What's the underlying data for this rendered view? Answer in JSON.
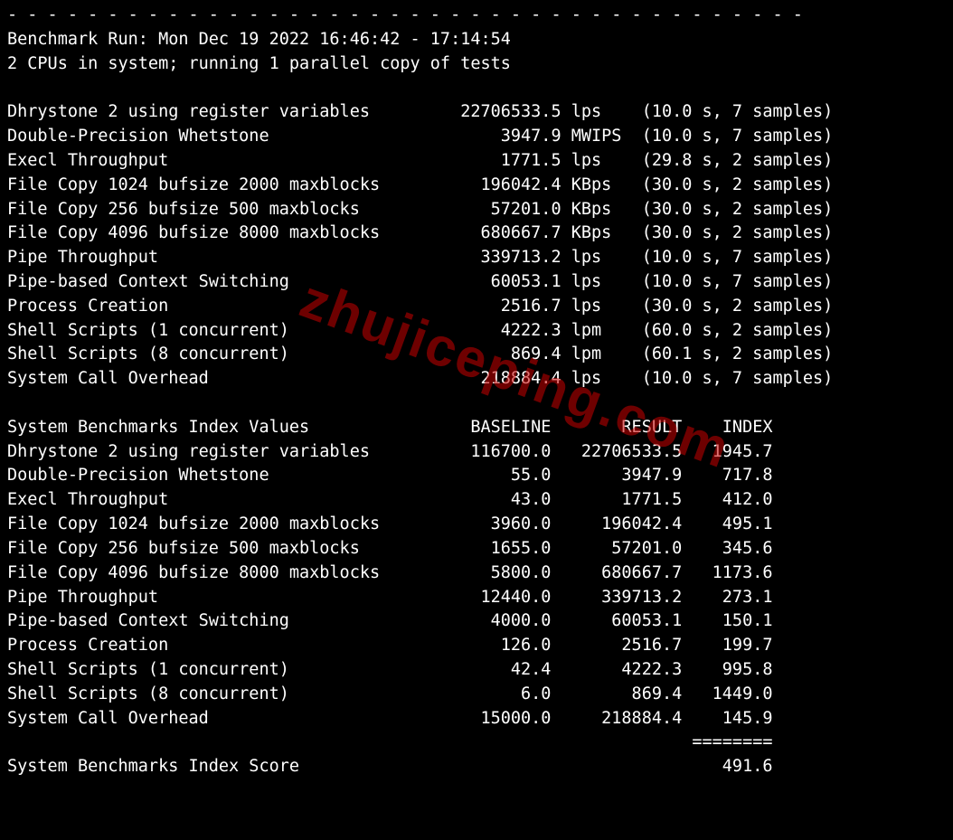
{
  "header": {
    "separator": "- - - - - - - - - - - - - - - - - - - - - - - - - - - - - - - - - - - - - - - -",
    "run_line": "Benchmark Run: Mon Dec 19 2022 16:46:42 - 17:14:54",
    "cpu_line": "2 CPUs in system; running 1 parallel copy of tests"
  },
  "raw_results": [
    {
      "name": "Dhrystone 2 using register variables",
      "value": "22706533.5",
      "unit": "lps",
      "timing": "(10.0 s, 7 samples)"
    },
    {
      "name": "Double-Precision Whetstone",
      "value": "3947.9",
      "unit": "MWIPS",
      "timing": "(10.0 s, 7 samples)"
    },
    {
      "name": "Execl Throughput",
      "value": "1771.5",
      "unit": "lps",
      "timing": "(29.8 s, 2 samples)"
    },
    {
      "name": "File Copy 1024 bufsize 2000 maxblocks",
      "value": "196042.4",
      "unit": "KBps",
      "timing": "(30.0 s, 2 samples)"
    },
    {
      "name": "File Copy 256 bufsize 500 maxblocks",
      "value": "57201.0",
      "unit": "KBps",
      "timing": "(30.0 s, 2 samples)"
    },
    {
      "name": "File Copy 4096 bufsize 8000 maxblocks",
      "value": "680667.7",
      "unit": "KBps",
      "timing": "(30.0 s, 2 samples)"
    },
    {
      "name": "Pipe Throughput",
      "value": "339713.2",
      "unit": "lps",
      "timing": "(10.0 s, 7 samples)"
    },
    {
      "name": "Pipe-based Context Switching",
      "value": "60053.1",
      "unit": "lps",
      "timing": "(10.0 s, 7 samples)"
    },
    {
      "name": "Process Creation",
      "value": "2516.7",
      "unit": "lps",
      "timing": "(30.0 s, 2 samples)"
    },
    {
      "name": "Shell Scripts (1 concurrent)",
      "value": "4222.3",
      "unit": "lpm",
      "timing": "(60.0 s, 2 samples)"
    },
    {
      "name": "Shell Scripts (8 concurrent)",
      "value": "869.4",
      "unit": "lpm",
      "timing": "(60.1 s, 2 samples)"
    },
    {
      "name": "System Call Overhead",
      "value": "218884.4",
      "unit": "lps",
      "timing": "(10.0 s, 7 samples)"
    }
  ],
  "index_header": {
    "title": "System Benchmarks Index Values",
    "baseline": "BASELINE",
    "result": "RESULT",
    "index": "INDEX"
  },
  "index_rows": [
    {
      "name": "Dhrystone 2 using register variables",
      "baseline": "116700.0",
      "result": "22706533.5",
      "index": "1945.7"
    },
    {
      "name": "Double-Precision Whetstone",
      "baseline": "55.0",
      "result": "3947.9",
      "index": "717.8"
    },
    {
      "name": "Execl Throughput",
      "baseline": "43.0",
      "result": "1771.5",
      "index": "412.0"
    },
    {
      "name": "File Copy 1024 bufsize 2000 maxblocks",
      "baseline": "3960.0",
      "result": "196042.4",
      "index": "495.1"
    },
    {
      "name": "File Copy 256 bufsize 500 maxblocks",
      "baseline": "1655.0",
      "result": "57201.0",
      "index": "345.6"
    },
    {
      "name": "File Copy 4096 bufsize 8000 maxblocks",
      "baseline": "5800.0",
      "result": "680667.7",
      "index": "1173.6"
    },
    {
      "name": "Pipe Throughput",
      "baseline": "12440.0",
      "result": "339713.2",
      "index": "273.1"
    },
    {
      "name": "Pipe-based Context Switching",
      "baseline": "4000.0",
      "result": "60053.1",
      "index": "150.1"
    },
    {
      "name": "Process Creation",
      "baseline": "126.0",
      "result": "2516.7",
      "index": "199.7"
    },
    {
      "name": "Shell Scripts (1 concurrent)",
      "baseline": "42.4",
      "result": "4222.3",
      "index": "995.8"
    },
    {
      "name": "Shell Scripts (8 concurrent)",
      "baseline": "6.0",
      "result": "869.4",
      "index": "1449.0"
    },
    {
      "name": "System Call Overhead",
      "baseline": "15000.0",
      "result": "218884.4",
      "index": "145.9"
    }
  ],
  "footer": {
    "rule": "========",
    "label": "System Benchmarks Index Score",
    "score": "491.6"
  },
  "watermark": "zhujiceping.com",
  "chart_data": {
    "type": "table",
    "title": "UnixBench System Benchmarks Index",
    "categories": [
      "Dhrystone 2 using register variables",
      "Double-Precision Whetstone",
      "Execl Throughput",
      "File Copy 1024 bufsize 2000 maxblocks",
      "File Copy 256 bufsize 500 maxblocks",
      "File Copy 4096 bufsize 8000 maxblocks",
      "Pipe Throughput",
      "Pipe-based Context Switching",
      "Process Creation",
      "Shell Scripts (1 concurrent)",
      "Shell Scripts (8 concurrent)",
      "System Call Overhead"
    ],
    "series": [
      {
        "name": "BASELINE",
        "values": [
          116700.0,
          55.0,
          43.0,
          3960.0,
          1655.0,
          5800.0,
          12440.0,
          4000.0,
          126.0,
          42.4,
          6.0,
          15000.0
        ]
      },
      {
        "name": "RESULT",
        "values": [
          22706533.5,
          3947.9,
          1771.5,
          196042.4,
          57201.0,
          680667.7,
          339713.2,
          60053.1,
          2516.7,
          4222.3,
          869.4,
          218884.4
        ]
      },
      {
        "name": "INDEX",
        "values": [
          1945.7,
          717.8,
          412.0,
          495.1,
          345.6,
          1173.6,
          273.1,
          150.1,
          199.7,
          995.8,
          1449.0,
          145.9
        ]
      }
    ],
    "overall_index": 491.6
  }
}
